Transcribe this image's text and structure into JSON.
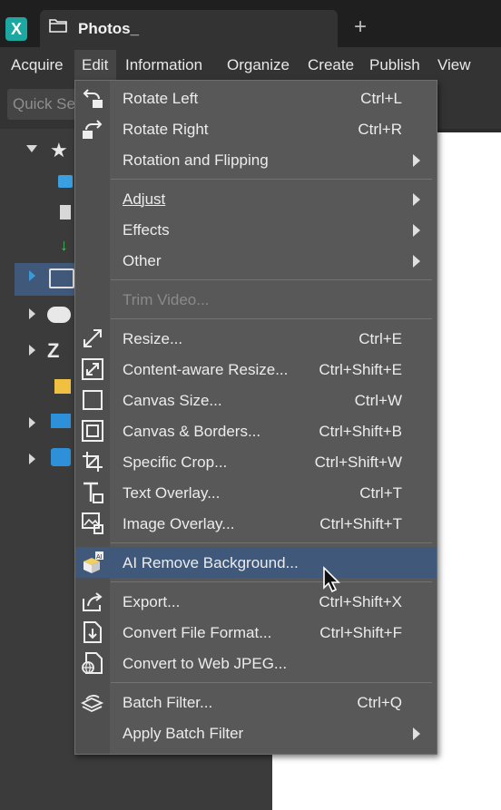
{
  "window": {
    "app_logo": "X",
    "tab_title": "Photos_",
    "new_tab": "+"
  },
  "menubar": {
    "items": [
      "Acquire",
      "Edit",
      "Information",
      "Organize",
      "Create",
      "Publish",
      "View"
    ]
  },
  "toolbar": {
    "search_placeholder": "Quick Se"
  },
  "edit_menu": {
    "items": [
      {
        "label": "Rotate Left",
        "shortcut": "Ctrl+L",
        "icon": "rotate-left-icon"
      },
      {
        "label": "Rotate Right",
        "shortcut": "Ctrl+R",
        "icon": "rotate-right-icon"
      },
      {
        "label": "Rotation and Flipping",
        "submenu": true
      },
      {
        "label": "Adjust",
        "submenu": true
      },
      {
        "label": "Effects",
        "submenu": true
      },
      {
        "label": "Other",
        "submenu": true
      },
      {
        "label": "Trim Video...",
        "disabled": true
      },
      {
        "label": "Resize...",
        "shortcut": "Ctrl+E",
        "icon": "resize-icon"
      },
      {
        "label": "Content-aware Resize...",
        "shortcut": "Ctrl+Shift+E",
        "icon": "content-aware-resize-icon"
      },
      {
        "label": "Canvas Size...",
        "shortcut": "Ctrl+W",
        "icon": "canvas-size-icon"
      },
      {
        "label": "Canvas & Borders...",
        "shortcut": "Ctrl+Shift+B",
        "icon": "canvas-borders-icon"
      },
      {
        "label": "Specific Crop...",
        "shortcut": "Ctrl+Shift+W",
        "icon": "crop-icon"
      },
      {
        "label": "Text Overlay...",
        "shortcut": "Ctrl+T",
        "icon": "text-overlay-icon"
      },
      {
        "label": "Image Overlay...",
        "shortcut": "Ctrl+Shift+T",
        "icon": "image-overlay-icon"
      },
      {
        "label": "AI Remove Background...",
        "icon": "ai-remove-background-icon",
        "highlighted": true
      },
      {
        "label": "Export...",
        "shortcut": "Ctrl+Shift+X",
        "icon": "export-icon"
      },
      {
        "label": "Convert File Format...",
        "shortcut": "Ctrl+Shift+F",
        "icon": "convert-format-icon"
      },
      {
        "label": "Convert to Web JPEG...",
        "icon": "web-jpeg-icon"
      },
      {
        "label": "Batch Filter...",
        "shortcut": "Ctrl+Q",
        "icon": "batch-filter-icon"
      },
      {
        "label": "Apply Batch Filter",
        "submenu": true
      }
    ]
  },
  "colors": {
    "highlight": "#40587a",
    "menu_bg": "#585858",
    "accent_teal": "#1ea6a0"
  }
}
